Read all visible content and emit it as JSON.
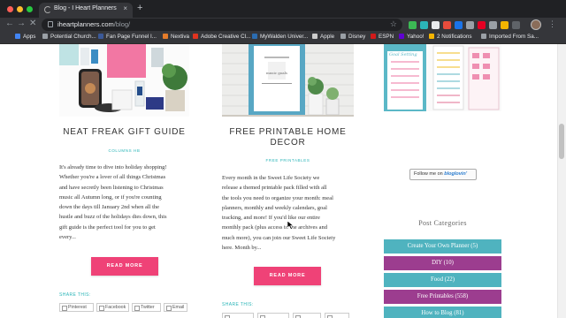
{
  "browser": {
    "tab_title": "Blog - I Heart Planners",
    "tab_close": "×",
    "new_tab": "+",
    "url_domain": "iheartplanners.com",
    "url_path": "/blog/",
    "back": "←",
    "forward": "→",
    "reload": "✕",
    "star": "☆",
    "menu": "⋮",
    "bookmarks": [
      {
        "label": "Apps",
        "color": "#4285f4"
      },
      {
        "label": "Potential Church...",
        "color": "#9aa0a6"
      },
      {
        "label": "Fan Page Funnel I...",
        "color": "#3b5998"
      },
      {
        "label": "Nextiva",
        "color": "#e57c2a"
      },
      {
        "label": "Adobe Creative Cl...",
        "color": "#e0331f"
      },
      {
        "label": "MyWalden Univer...",
        "color": "#2b6cb0"
      },
      {
        "label": "Apple",
        "color": "#cccccc"
      },
      {
        "label": "Disney",
        "color": "#9aa0a6"
      },
      {
        "label": "ESPN",
        "color": "#d21a1a"
      },
      {
        "label": "Yahoo!",
        "color": "#6001d2"
      },
      {
        "label": "2 Notifications",
        "color": "#f4b400"
      },
      {
        "label": "Imported From Sa...",
        "color": "#9aa0a6"
      }
    ]
  },
  "posts": [
    {
      "title": "NEAT FREAK GIFT GUIDE",
      "category": "COLUMNS HB",
      "excerpt": [
        "It's already time to dive into holiday shopping!",
        "Whether you're a lover of all things Christmas",
        "and have secretly been listening to Christmas",
        "music all Autumn long, or if you're counting",
        "down the days till January 2nd when all the",
        "hustle and buzz of the holidays dies down, this",
        "gift guide is the perfect tool for you to get",
        "every..."
      ],
      "read_more": "READ MORE",
      "share_label": "SHARE THIS:",
      "share_buttons": [
        "Pinterest",
        "Facebook",
        "Twitter",
        "Email"
      ]
    },
    {
      "title_line1": "FREE PRINTABLE HOME",
      "title_line2": "DECOR",
      "category": "FREE PRINTABLES",
      "poster_text": "music goals",
      "excerpt": [
        "Every month in the Sweet Life Society we",
        "release a themed printable pack filled with all",
        "the tools you need to organize your month: meal",
        "planners, monthly and weekly calendars, goal",
        "tracking, and more! If you'd like our entire",
        "monthly pack (plus access to the archives and",
        "much more), you can join our Sweet Life Society",
        "here.    Month by..."
      ],
      "read_more": "READ MORE",
      "share_label": "SHARE THIS:"
    }
  ],
  "sidebar": {
    "planner_text": "Goal Setting",
    "follow_prefix": "Follow me on ",
    "follow_brand": "bloglovin'",
    "categories_heading": "Post Categories",
    "categories": [
      {
        "label": "Create Your Own Planner (5)",
        "color": "#4fb3bf"
      },
      {
        "label": "DIY (10)",
        "color": "#9c3d8f"
      },
      {
        "label": "Food (22)",
        "color": "#4fb3bf"
      },
      {
        "label": "Free Printables (558)",
        "color": "#9c3d8f"
      },
      {
        "label": "How to Blog (81)",
        "color": "#4fb3bf"
      }
    ]
  }
}
